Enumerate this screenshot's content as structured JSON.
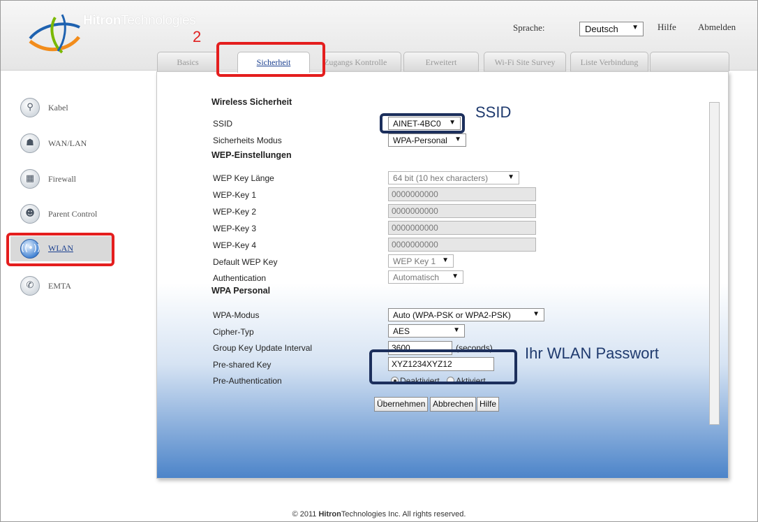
{
  "header": {
    "logo_bold": "Hitron",
    "logo_light": "Technologies",
    "language_label": "Sprache:",
    "language_value": "Deutsch",
    "help_link": "Hilfe",
    "logout_link": "Abmelden"
  },
  "annotation": {
    "step_number": "2",
    "ssid_callout": "SSID",
    "password_callout": "Ihr WLAN Passwort"
  },
  "tabs": [
    {
      "label": "Basics"
    },
    {
      "label": "Sicherheit"
    },
    {
      "label": "Zugangs Kontrolle"
    },
    {
      "label": "Erweitert"
    },
    {
      "label": "Wi-Fi Site Survey"
    },
    {
      "label": "Liste Verbindung"
    }
  ],
  "sidebar": {
    "items": [
      {
        "label": "Kabel",
        "icon": "wrench-icon"
      },
      {
        "label": "WAN/LAN",
        "icon": "network-icon"
      },
      {
        "label": "Firewall",
        "icon": "firewall-icon"
      },
      {
        "label": "Parent Control",
        "icon": "users-icon"
      },
      {
        "label": "WLAN",
        "icon": "wireless-icon"
      },
      {
        "label": "EMTA",
        "icon": "phone-icon"
      }
    ]
  },
  "form": {
    "section_wireless": "Wireless Sicherheit",
    "ssid_label": "SSID",
    "ssid_value": "AINET-4BC0",
    "security_mode_label": "Sicherheits Modus",
    "security_mode_value": "WPA-Personal",
    "section_wep": "WEP-Einstellungen",
    "wep_key_length_label": "WEP Key Länge",
    "wep_key_length_value": "64 bit (10 hex characters)",
    "wep_key1_label": "WEP-Key 1",
    "wep_key1_value": "0000000000",
    "wep_key2_label": "WEP-Key 2",
    "wep_key2_value": "0000000000",
    "wep_key3_label": "WEP-Key 3",
    "wep_key3_value": "0000000000",
    "wep_key4_label": "WEP-Key 4",
    "wep_key4_value": "0000000000",
    "default_wep_key_label": "Default WEP Key",
    "default_wep_key_value": "WEP Key 1",
    "authentication_label": "Authentication",
    "authentication_value": "Automatisch",
    "section_wpa": "WPA Personal",
    "wpa_mode_label": "WPA-Modus",
    "wpa_mode_value": "Auto (WPA-PSK or WPA2-PSK)",
    "cipher_label": "Cipher-Typ",
    "cipher_value": "AES",
    "group_key_label": "Group Key Update Interval",
    "group_key_value": "3600",
    "group_key_unit": "(seconds)",
    "psk_label": "Pre-shared Key",
    "psk_value": "XYZ1234XYZ12",
    "preauth_label": "Pre-Authentication",
    "preauth_off": "Deaktiviert",
    "preauth_on": "Aktiviert"
  },
  "buttons": {
    "apply": "Übernehmen",
    "cancel": "Abbrechen",
    "help": "Hilfe"
  },
  "footer": {
    "copy": "© 2011",
    "brand_bold": "Hitron",
    "brand_light": "Technologies",
    "suffix": "Inc.  All rights reserved."
  }
}
